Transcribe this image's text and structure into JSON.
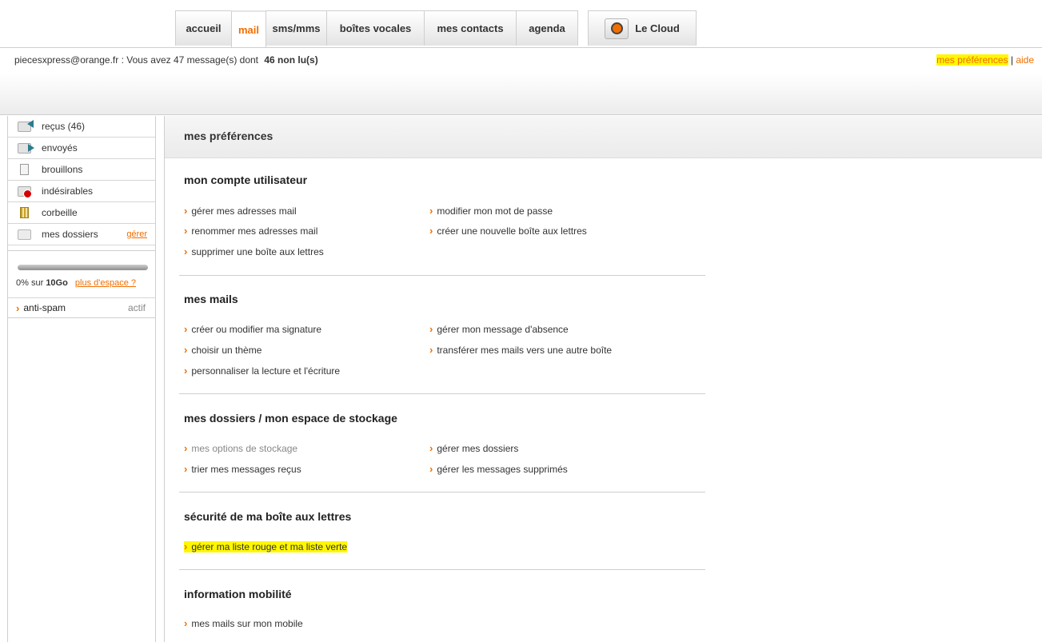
{
  "tabs": [
    {
      "label": "accueil"
    },
    {
      "label": "mail"
    },
    {
      "label": "sms/mms"
    },
    {
      "label": "boîtes vocales"
    },
    {
      "label": "mes contacts"
    },
    {
      "label": "agenda"
    },
    {
      "label": "Le Cloud"
    }
  ],
  "topbar": {
    "message": "piecesxpress@orange.fr : Vous avez 47 message(s) dont",
    "unread": "46 non lu(s)",
    "prefs_link": "mes préférences",
    "separator": "|",
    "help_link": "aide"
  },
  "sidebar": {
    "folders": [
      {
        "label": "reçus (46)",
        "icon": "inbox-icon"
      },
      {
        "label": "envoyés",
        "icon": "sent-icon"
      },
      {
        "label": "brouillons",
        "icon": "drafts-icon"
      },
      {
        "label": "indésirables",
        "icon": "spam-icon"
      },
      {
        "label": "corbeille",
        "icon": "trash-icon"
      },
      {
        "label": "mes dossiers",
        "icon": "folder-icon"
      }
    ],
    "manage_link": "gérer",
    "quota": {
      "percent": 0,
      "text": "0% sur",
      "size": "10Go",
      "more_link": "plus d'espace ?"
    },
    "antispam": {
      "label": "anti-spam",
      "status": "actif"
    }
  },
  "main": {
    "title": "mes préférences",
    "sections": [
      {
        "title": "mon compte utilisateur",
        "links": [
          "gérer mes adresses mail",
          "modifier mon mot de passe",
          "renommer mes adresses mail",
          "créer une nouvelle boîte aux lettres",
          "supprimer une boîte aux lettres"
        ]
      },
      {
        "title": "mes mails",
        "links": [
          "créer ou modifier ma signature",
          "gérer mon message d'absence",
          "choisir un thème",
          "transférer mes mails vers une autre boîte",
          "personnaliser la lecture et l'écriture"
        ]
      },
      {
        "title": "mes dossiers / mon espace de stockage",
        "links": [
          "mes options de stockage",
          "gérer mes dossiers",
          "trier mes messages reçus",
          "gérer les messages supprimés"
        ]
      },
      {
        "title": "sécurité de ma boîte aux lettres",
        "links": [
          "gérer ma liste rouge et ma liste verte"
        ]
      },
      {
        "title": "information mobilité",
        "links": [
          "mes mails sur mon mobile"
        ]
      }
    ]
  },
  "colors": {
    "accent": "#f16e00",
    "highlight": "#fff700"
  }
}
